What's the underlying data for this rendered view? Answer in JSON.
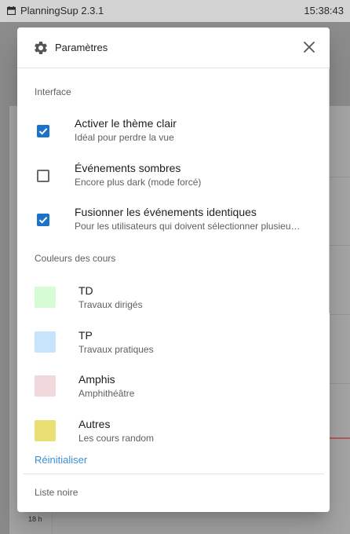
{
  "titlebar": {
    "app_title": "PlanningSup 2.3.1",
    "clock": "15:38:43"
  },
  "background": {
    "hour_label": "18 h"
  },
  "dialog": {
    "title": "Paramètres",
    "interface_section": "Interface",
    "options": [
      {
        "label": "Activer le thème clair",
        "sub": "Idéal pour perdre la vue",
        "checked": true
      },
      {
        "label": "Événements sombres",
        "sub": "Encore plus dark (mode forcé)",
        "checked": false
      },
      {
        "label": "Fusionner les événements identiques",
        "sub": "Pour les utilisateurs qui doivent sélectionner plusieu…",
        "checked": true
      }
    ],
    "colors_section": "Couleurs des cours",
    "colors": [
      {
        "name": "TD",
        "desc": "Travaux dirigés",
        "color": "#d6fcd6"
      },
      {
        "name": "TP",
        "desc": "Travaux pratiques",
        "color": "#c8e4fd"
      },
      {
        "name": "Amphis",
        "desc": "Amphithéâtre",
        "color": "#f0d8dd"
      },
      {
        "name": "Autres",
        "desc": "Les cours random",
        "color": "#eadf72"
      }
    ],
    "reset_label": "Réinitialiser",
    "blacklist_section": "Liste noire"
  },
  "theme": {
    "accent": "#1a73c9",
    "link": "#3a8fd6"
  }
}
